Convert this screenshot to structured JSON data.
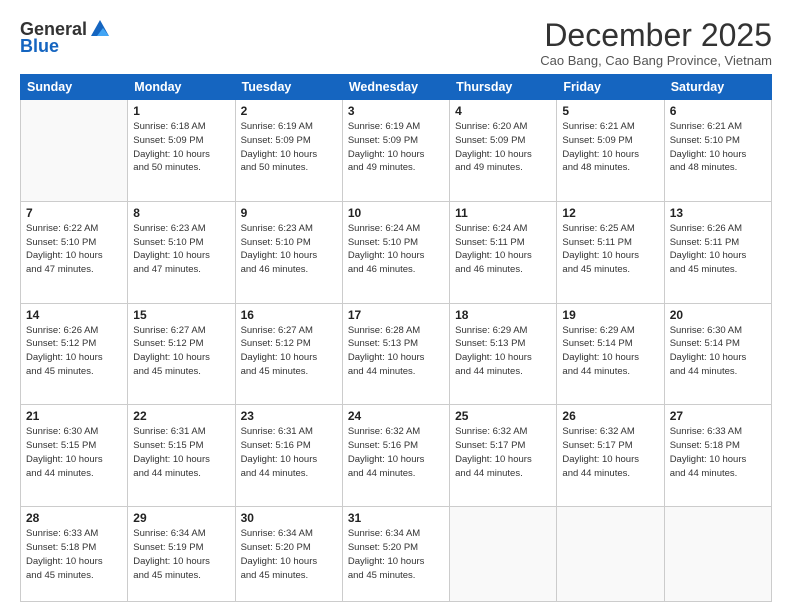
{
  "logo": {
    "general": "General",
    "blue": "Blue"
  },
  "header": {
    "title": "December 2025",
    "subtitle": "Cao Bang, Cao Bang Province, Vietnam"
  },
  "weekdays": [
    "Sunday",
    "Monday",
    "Tuesday",
    "Wednesday",
    "Thursday",
    "Friday",
    "Saturday"
  ],
  "weeks": [
    [
      {
        "day": "",
        "info": ""
      },
      {
        "day": "1",
        "info": "Sunrise: 6:18 AM\nSunset: 5:09 PM\nDaylight: 10 hours\nand 50 minutes."
      },
      {
        "day": "2",
        "info": "Sunrise: 6:19 AM\nSunset: 5:09 PM\nDaylight: 10 hours\nand 50 minutes."
      },
      {
        "day": "3",
        "info": "Sunrise: 6:19 AM\nSunset: 5:09 PM\nDaylight: 10 hours\nand 49 minutes."
      },
      {
        "day": "4",
        "info": "Sunrise: 6:20 AM\nSunset: 5:09 PM\nDaylight: 10 hours\nand 49 minutes."
      },
      {
        "day": "5",
        "info": "Sunrise: 6:21 AM\nSunset: 5:09 PM\nDaylight: 10 hours\nand 48 minutes."
      },
      {
        "day": "6",
        "info": "Sunrise: 6:21 AM\nSunset: 5:10 PM\nDaylight: 10 hours\nand 48 minutes."
      }
    ],
    [
      {
        "day": "7",
        "info": "Sunrise: 6:22 AM\nSunset: 5:10 PM\nDaylight: 10 hours\nand 47 minutes."
      },
      {
        "day": "8",
        "info": "Sunrise: 6:23 AM\nSunset: 5:10 PM\nDaylight: 10 hours\nand 47 minutes."
      },
      {
        "day": "9",
        "info": "Sunrise: 6:23 AM\nSunset: 5:10 PM\nDaylight: 10 hours\nand 46 minutes."
      },
      {
        "day": "10",
        "info": "Sunrise: 6:24 AM\nSunset: 5:10 PM\nDaylight: 10 hours\nand 46 minutes."
      },
      {
        "day": "11",
        "info": "Sunrise: 6:24 AM\nSunset: 5:11 PM\nDaylight: 10 hours\nand 46 minutes."
      },
      {
        "day": "12",
        "info": "Sunrise: 6:25 AM\nSunset: 5:11 PM\nDaylight: 10 hours\nand 45 minutes."
      },
      {
        "day": "13",
        "info": "Sunrise: 6:26 AM\nSunset: 5:11 PM\nDaylight: 10 hours\nand 45 minutes."
      }
    ],
    [
      {
        "day": "14",
        "info": "Sunrise: 6:26 AM\nSunset: 5:12 PM\nDaylight: 10 hours\nand 45 minutes."
      },
      {
        "day": "15",
        "info": "Sunrise: 6:27 AM\nSunset: 5:12 PM\nDaylight: 10 hours\nand 45 minutes."
      },
      {
        "day": "16",
        "info": "Sunrise: 6:27 AM\nSunset: 5:12 PM\nDaylight: 10 hours\nand 45 minutes."
      },
      {
        "day": "17",
        "info": "Sunrise: 6:28 AM\nSunset: 5:13 PM\nDaylight: 10 hours\nand 44 minutes."
      },
      {
        "day": "18",
        "info": "Sunrise: 6:29 AM\nSunset: 5:13 PM\nDaylight: 10 hours\nand 44 minutes."
      },
      {
        "day": "19",
        "info": "Sunrise: 6:29 AM\nSunset: 5:14 PM\nDaylight: 10 hours\nand 44 minutes."
      },
      {
        "day": "20",
        "info": "Sunrise: 6:30 AM\nSunset: 5:14 PM\nDaylight: 10 hours\nand 44 minutes."
      }
    ],
    [
      {
        "day": "21",
        "info": "Sunrise: 6:30 AM\nSunset: 5:15 PM\nDaylight: 10 hours\nand 44 minutes."
      },
      {
        "day": "22",
        "info": "Sunrise: 6:31 AM\nSunset: 5:15 PM\nDaylight: 10 hours\nand 44 minutes."
      },
      {
        "day": "23",
        "info": "Sunrise: 6:31 AM\nSunset: 5:16 PM\nDaylight: 10 hours\nand 44 minutes."
      },
      {
        "day": "24",
        "info": "Sunrise: 6:32 AM\nSunset: 5:16 PM\nDaylight: 10 hours\nand 44 minutes."
      },
      {
        "day": "25",
        "info": "Sunrise: 6:32 AM\nSunset: 5:17 PM\nDaylight: 10 hours\nand 44 minutes."
      },
      {
        "day": "26",
        "info": "Sunrise: 6:32 AM\nSunset: 5:17 PM\nDaylight: 10 hours\nand 44 minutes."
      },
      {
        "day": "27",
        "info": "Sunrise: 6:33 AM\nSunset: 5:18 PM\nDaylight: 10 hours\nand 44 minutes."
      }
    ],
    [
      {
        "day": "28",
        "info": "Sunrise: 6:33 AM\nSunset: 5:18 PM\nDaylight: 10 hours\nand 45 minutes."
      },
      {
        "day": "29",
        "info": "Sunrise: 6:34 AM\nSunset: 5:19 PM\nDaylight: 10 hours\nand 45 minutes."
      },
      {
        "day": "30",
        "info": "Sunrise: 6:34 AM\nSunset: 5:20 PM\nDaylight: 10 hours\nand 45 minutes."
      },
      {
        "day": "31",
        "info": "Sunrise: 6:34 AM\nSunset: 5:20 PM\nDaylight: 10 hours\nand 45 minutes."
      },
      {
        "day": "",
        "info": ""
      },
      {
        "day": "",
        "info": ""
      },
      {
        "day": "",
        "info": ""
      }
    ]
  ]
}
